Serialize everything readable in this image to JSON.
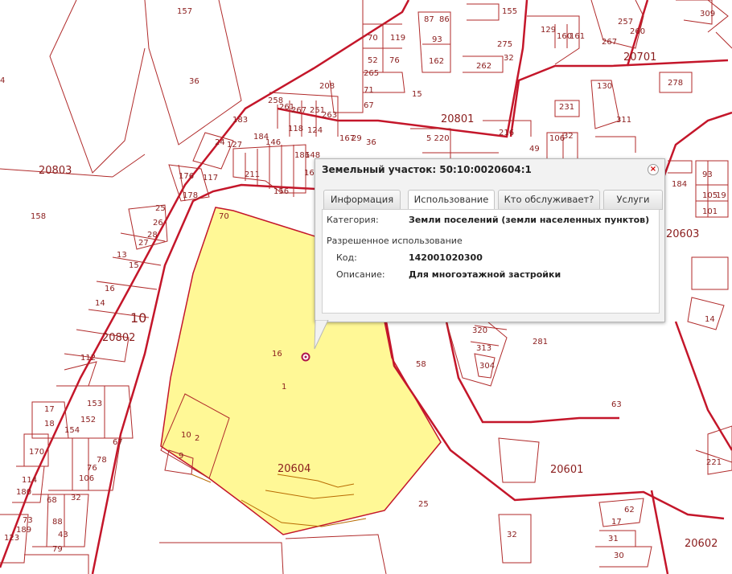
{
  "map": {
    "quarters": {
      "q20803": "20803",
      "q20802": "20802",
      "q20604": "20604",
      "q20601": "20601",
      "q20602": "20602",
      "q20603": "20603",
      "q20801": "20801",
      "q20701": "20701",
      "q10": "10"
    },
    "labels": {
      "l157": "157",
      "l36": "36",
      "l158": "158",
      "l4": "4",
      "l70a": "70",
      "l119": "119",
      "l52": "52",
      "l76": "76",
      "l87": "87",
      "l86": "86",
      "l93": "93",
      "l162": "162",
      "l265": "265",
      "l71": "71",
      "l67": "67",
      "l208": "208",
      "l15": "15",
      "l258": "258",
      "l261": "261",
      "l267": "267",
      "l251": "251",
      "l263": "263",
      "l183": "183",
      "l118": "118",
      "l124": "124",
      "l167": "167",
      "l29": "29",
      "l36b": "36",
      "l220": "5 220",
      "l146": "146",
      "l184": "184",
      "l211": "211",
      "l148": "148",
      "l166": "166",
      "l186": "186",
      "l24": "24",
      "l127": "127",
      "l117": "117",
      "l176": "176",
      "l178": "178",
      "l156": "156",
      "l25": "25",
      "l26": "26",
      "l27": "27",
      "l28": "28",
      "l13": "13",
      "l15b": "15",
      "l16": "16",
      "l14": "14",
      "l112": "112",
      "l155": "155",
      "l129": "129",
      "l160": "160",
      "l161": "161",
      "l275": "275",
      "l32": "32",
      "l262": "262",
      "l257": "257",
      "l260": "260",
      "l267b": "267",
      "l309": "309",
      "l278": "278",
      "l130": "130",
      "l231": "231",
      "l311": "311",
      "l216": "216",
      "l106": "106",
      "l32b": "32",
      "l49": "49",
      "l70": "70",
      "l16p": "16",
      "l1": "1",
      "l10": "10",
      "l2": "2",
      "l9": "9",
      "l58": "58",
      "l281": "281",
      "l320": "320",
      "l313": "313",
      "l304": "304",
      "l63": "63",
      "l25b": "25",
      "l62": "62",
      "l17": "17",
      "l31": "31",
      "l30": "30",
      "l32c": "32",
      "l153": "153",
      "l152": "152",
      "l17b": "17",
      "l18": "18",
      "l154": "154",
      "l170": "170",
      "l67b": "67",
      "l78": "78",
      "l76b": "76",
      "l106b": "106",
      "l114": "114",
      "l180": "180",
      "l68": "68",
      "l32d": "32",
      "l73": "73",
      "l88": "88",
      "l189": "189",
      "l123": "123",
      "l43": "43",
      "l79": "79",
      "l14b": "14",
      "l184b": "184",
      "l93b": "93",
      "l105": "105",
      "l19": "19",
      "l101": "101",
      "l221": "221"
    }
  },
  "popup": {
    "title": "Земельный участок: 50:10:0020604:1",
    "close_label": "×",
    "tabs": [
      "Информация",
      "Использование",
      "Кто обслуживает?",
      "Услуги"
    ],
    "active_tab": "Использование",
    "category_label": "Категория:",
    "category_value": "Земли поселений (земли населенных пунктов)",
    "allowed_use_header": "Разрешенное использование",
    "code_label": "Код:",
    "code_value": "142001020300",
    "description_label": "Описание:",
    "description_value": "Для многоэтажной застройки"
  },
  "colors": {
    "parcel_fill": "#fff896",
    "boundary": "#c4162a",
    "parcel_line": "#b02a2a"
  }
}
